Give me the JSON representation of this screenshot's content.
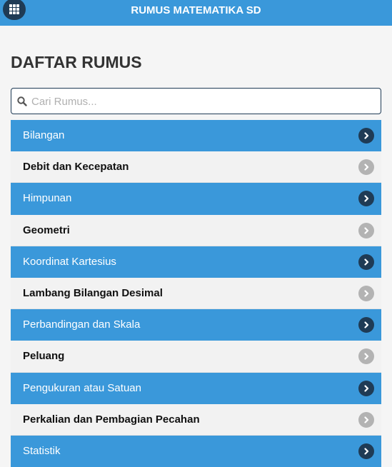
{
  "header": {
    "title": "RUMUS MATEMATIKA SD",
    "menu_icon": "grid-icon"
  },
  "page": {
    "title": "DAFTAR RUMUS"
  },
  "search": {
    "placeholder": "Cari Rumus...",
    "value": "",
    "icon": "search-icon"
  },
  "colors": {
    "accent": "#3a98da",
    "dark": "#1f3b55",
    "muted_chevron": "#b3b3b3"
  },
  "items": [
    {
      "label": "Bilangan"
    },
    {
      "label": "Debit dan Kecepatan"
    },
    {
      "label": "Himpunan"
    },
    {
      "label": "Geometri"
    },
    {
      "label": "Koordinat Kartesius"
    },
    {
      "label": "Lambang Bilangan Desimal"
    },
    {
      "label": "Perbandingan dan Skala"
    },
    {
      "label": "Peluang"
    },
    {
      "label": "Pengukuran atau Satuan"
    },
    {
      "label": "Perkalian dan Pembagian Pecahan"
    },
    {
      "label": "Statistik"
    }
  ]
}
